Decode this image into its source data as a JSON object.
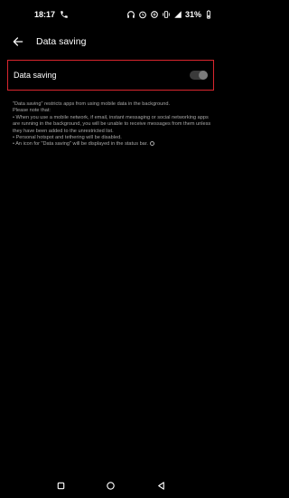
{
  "status": {
    "time": "18:17",
    "battery": "31%"
  },
  "header": {
    "title": "Data saving"
  },
  "setting": {
    "label": "Data saving",
    "enabled": false
  },
  "description": [
    "\"Data saving\" restricts apps from using mobile data in the background.",
    "Please note that:",
    "• When you use a mobile network, if email, instant messaging or social networking apps are running in the background, you will be unable to receive messages from them unless they have been added to the unrestricted list.",
    "• Personal hotspot and tethering will be disabled.",
    "• An icon for \"Data saving\" will be displayed in the status bar."
  ],
  "colors": {
    "background": "#000000",
    "highlight": "#d9262e",
    "toggle_off": "#3a3a3a"
  }
}
